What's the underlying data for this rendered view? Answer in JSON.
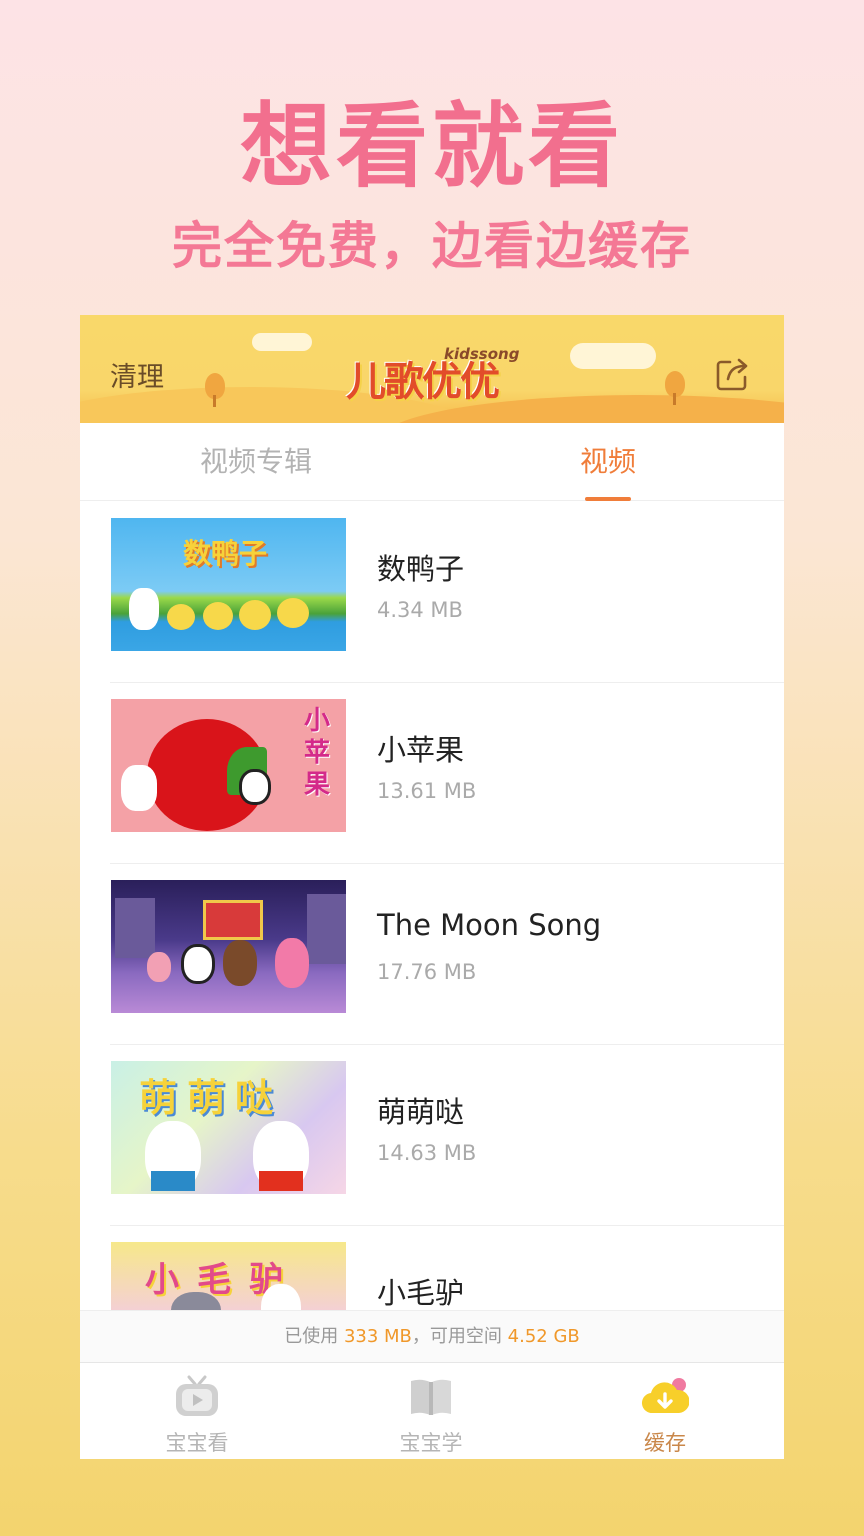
{
  "promo": {
    "title": "想看就看",
    "subtitle": "完全免费，边看边缓存"
  },
  "header": {
    "clean_label": "清理",
    "logo_text": "儿歌优优",
    "logo_sub": "kidssong"
  },
  "tabs": [
    {
      "label": "视频专辑",
      "active": false
    },
    {
      "label": "视频",
      "active": true
    }
  ],
  "videos": [
    {
      "title": "数鸭子",
      "size": "4.34 MB",
      "thumb_text": "数鸭子"
    },
    {
      "title": "小苹果",
      "size": "13.61 MB",
      "thumb_text": "小苹果"
    },
    {
      "title": "The Moon Song",
      "size": "17.76 MB",
      "thumb_text": ""
    },
    {
      "title": "萌萌哒",
      "size": "14.63 MB",
      "thumb_text": "萌萌哒"
    },
    {
      "title": "小毛驴",
      "size": "",
      "thumb_text": "小毛驴"
    }
  ],
  "storage": {
    "prefix": "已使用 ",
    "used": "333 MB",
    "middle": "，可用空间 ",
    "free": "4.52 GB"
  },
  "nav": [
    {
      "label": "宝宝看",
      "icon": "tv-icon",
      "active": false
    },
    {
      "label": "宝宝学",
      "icon": "book-icon",
      "active": false
    },
    {
      "label": "缓存",
      "icon": "download-icon",
      "active": true
    }
  ],
  "colors": {
    "accent": "#f07d3a",
    "promo_pink": "#f26f8e",
    "header_yellow": "#f9d86a"
  }
}
